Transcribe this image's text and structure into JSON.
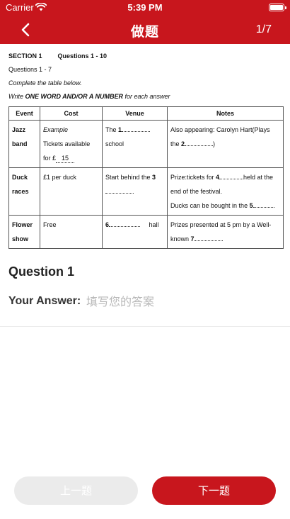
{
  "status_bar": {
    "carrier": "Carrier",
    "time": "5:39 PM"
  },
  "nav": {
    "title": "做题",
    "counter": "1/7"
  },
  "question_image": {
    "section": "SECTION 1",
    "questions_range": "Questions 1 - 10",
    "sub_range": "Questions 1 - 7",
    "instruction": "Complete the table below.",
    "write_prefix": "Write ",
    "write_bold": "ONE WORD AND/OR A NUMBER",
    "write_suffix": " for each answer",
    "headers": [
      "Event",
      "Cost",
      "Venue",
      "Notes"
    ],
    "rows": [
      {
        "event": "Jazz band",
        "cost_example": "Example",
        "cost_text": "Tickets available for £",
        "cost_blank": "15",
        "venue_pre": "The ",
        "venue_num": "1",
        "venue_post": "school",
        "notes_pre": "Also appearing: Carolyn Hart(Plays the ",
        "notes_num": "2",
        "notes_post": ")"
      },
      {
        "event": "Duck races",
        "cost": "£1 per duck",
        "venue_pre": "Start behind the ",
        "venue_num": "3",
        "notes_pre": "Prize:tickets for ",
        "notes_num": "4",
        "notes_mid": "held at the end of the festival.",
        "notes_line2": "Ducks can be bought in the ",
        "notes_num2": "5"
      },
      {
        "event": "Flower show",
        "cost": "Free",
        "venue_num": "6",
        "venue_post": "hall",
        "notes_pre": "Prizes presented at 5 pm by a Well-known ",
        "notes_num": "7"
      }
    ]
  },
  "question": {
    "title": "Question 1",
    "answer_label": "Your Answer:",
    "answer_placeholder": "填写您的答案",
    "answer_value": ""
  },
  "buttons": {
    "prev": "上一题",
    "next": "下一题"
  },
  "colors": {
    "brand": "#c8161d",
    "disabled_button": "#ebebeb"
  }
}
